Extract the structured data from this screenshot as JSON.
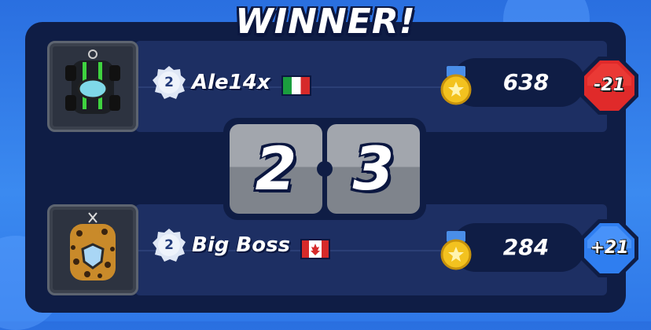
{
  "header": {
    "title": "WINNER!"
  },
  "players": [
    {
      "name": "Ale14x",
      "level": "2",
      "flag": "italy-flag",
      "trophies": "638",
      "delta": "-21",
      "delta_color": "#e02a2a"
    },
    {
      "name": "Big Boss",
      "level": "2",
      "flag": "canada-flag",
      "trophies": "284",
      "delta": "+21",
      "delta_color": "#2f7ef0"
    }
  ],
  "score": {
    "left": "2",
    "right": "3"
  },
  "colors": {
    "panel": "#0f1d45",
    "row": "#1d2f63",
    "background": "#2a6fe0"
  }
}
